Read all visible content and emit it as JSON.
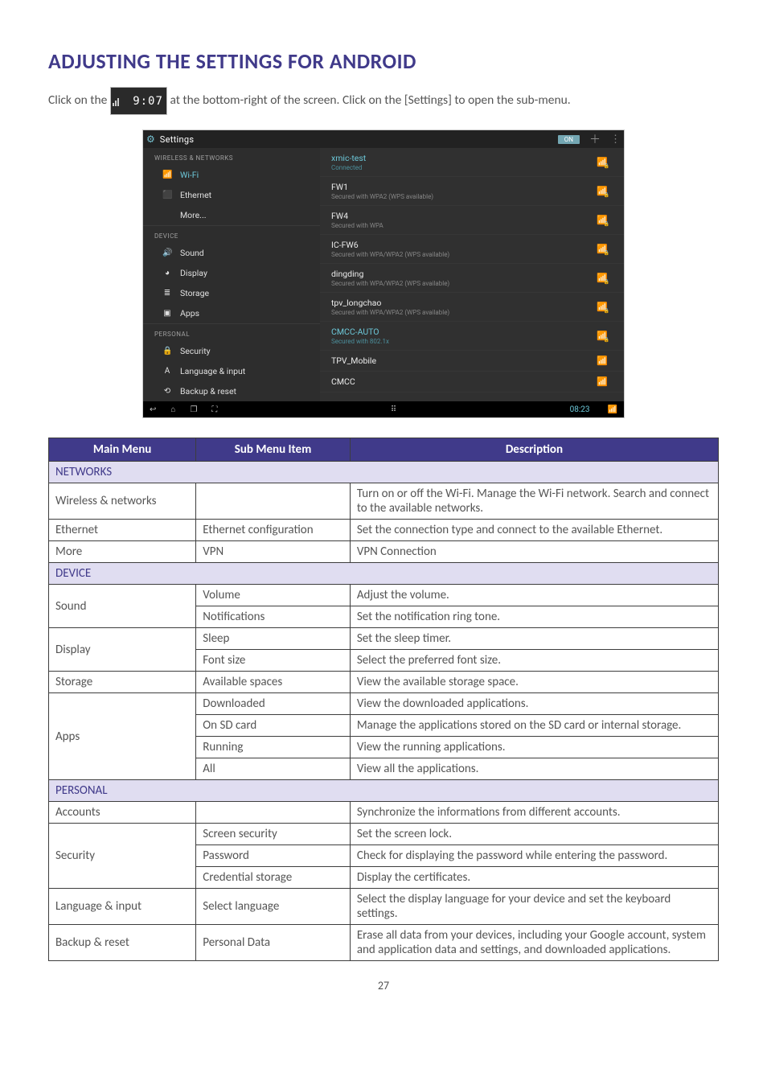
{
  "heading": "ADJUSTING THE SETTINGS FOR ANDROID",
  "intro_before": "Click on the ",
  "intro_after": " at the bottom-right of the screen. Click on the [Settings] to open the sub-menu.",
  "clock_inline": "9:07",
  "page_number": "27",
  "shot": {
    "title": "Settings",
    "toggle": "ON",
    "sidebar": {
      "cats": [
        {
          "label": "WIRELESS & NETWORKS",
          "items": [
            {
              "icon": "wifi-icon",
              "glyph": "📶",
              "label": "Wi-Fi",
              "selected": true
            },
            {
              "icon": "ethernet-icon",
              "glyph": "⬛",
              "label": "Ethernet"
            },
            {
              "icon": "",
              "glyph": "",
              "label": "More..."
            }
          ]
        },
        {
          "label": "DEVICE",
          "items": [
            {
              "icon": "sound-icon",
              "glyph": "🔊",
              "label": "Sound"
            },
            {
              "icon": "display-icon",
              "glyph": "◕",
              "label": "Display"
            },
            {
              "icon": "storage-icon",
              "glyph": "≣",
              "label": "Storage"
            },
            {
              "icon": "apps-icon",
              "glyph": "▣",
              "label": "Apps"
            }
          ]
        },
        {
          "label": "PERSONAL",
          "items": [
            {
              "icon": "security-icon",
              "glyph": "🔒",
              "label": "Security"
            },
            {
              "icon": "language-icon",
              "glyph": "A",
              "label": "Language & input"
            },
            {
              "icon": "backup-icon",
              "glyph": "⟲",
              "label": "Backup & reset"
            }
          ]
        }
      ]
    },
    "wifi": [
      {
        "ssid": "xmic-test",
        "sub": "Connected",
        "secured": true,
        "selected": true
      },
      {
        "ssid": "FW1",
        "sub": "Secured with WPA2 (WPS available)",
        "secured": true
      },
      {
        "ssid": "FW4",
        "sub": "Secured with WPA",
        "secured": true
      },
      {
        "ssid": "IC-FW6",
        "sub": "Secured with WPA/WPA2 (WPS available)",
        "secured": true
      },
      {
        "ssid": "dingding",
        "sub": "Secured with WPA/WPA2 (WPS available)",
        "secured": true
      },
      {
        "ssid": "tpv_longchao",
        "sub": "Secured with WPA/WPA2 (WPS available)",
        "secured": true
      },
      {
        "ssid": "CMCC-AUTO",
        "sub": "Secured with 802.1x",
        "secured": true,
        "selected": true
      },
      {
        "ssid": "TPV_Mobile",
        "sub": "",
        "secured": false
      },
      {
        "ssid": "CMCC",
        "sub": "",
        "secured": false
      }
    ],
    "nav_time": "08:23"
  },
  "table": {
    "headers": [
      "Main Menu",
      "Sub Menu Item",
      "Description"
    ],
    "sections": [
      {
        "title": "NETWORKS",
        "rows": [
          {
            "main": "Wireless & networks",
            "sub": "",
            "desc": "Turn on or off the Wi-Fi. Manage the Wi-Fi network. Search and connect to the available networks."
          },
          {
            "main": "Ethernet",
            "sub": "Ethernet configuration",
            "desc": "Set the connection type and connect to the available Ethernet."
          },
          {
            "main": "More",
            "sub": "VPN",
            "desc": "VPN Connection"
          }
        ]
      },
      {
        "title": "DEVICE",
        "rows": [
          {
            "main": "Sound",
            "span": 2,
            "sub": "Volume",
            "desc": "Adjust the volume."
          },
          {
            "main": "",
            "sub": "Notifications",
            "desc": "Set the notification ring tone."
          },
          {
            "main": "Display",
            "span": 2,
            "sub": "Sleep",
            "desc": "Set the sleep timer."
          },
          {
            "main": "",
            "sub": "Font size",
            "desc": "Select the preferred font size."
          },
          {
            "main": "Storage",
            "sub": "Available spaces",
            "desc": "View the available storage space."
          },
          {
            "main": "Apps",
            "span": 4,
            "sub": "Downloaded",
            "desc": "View the downloaded applications."
          },
          {
            "main": "",
            "sub": "On SD card",
            "desc": "Manage the applications stored on the SD card or internal storage."
          },
          {
            "main": "",
            "sub": "Running",
            "desc": "View the running applications."
          },
          {
            "main": "",
            "sub": "All",
            "desc": "View all the applications."
          }
        ]
      },
      {
        "title": "PERSONAL",
        "rows": [
          {
            "main": "Accounts",
            "sub": "",
            "desc": "Synchronize the informations from different accounts."
          },
          {
            "main": "Security",
            "span": 3,
            "sub": "Screen security",
            "desc": "Set the screen lock."
          },
          {
            "main": "",
            "sub": "Password",
            "desc": "Check for displaying the password while entering the password."
          },
          {
            "main": "",
            "sub": "Credential storage",
            "desc": "Display the certificates."
          },
          {
            "main": "Language & input",
            "sub": "Select language",
            "desc": "Select the display language for your device and set the keyboard settings."
          },
          {
            "main": "Backup & reset",
            "sub": "Personal Data",
            "desc": "Erase all data from your devices, including your Google account, system and application data and settings, and downloaded applications."
          }
        ]
      }
    ]
  }
}
